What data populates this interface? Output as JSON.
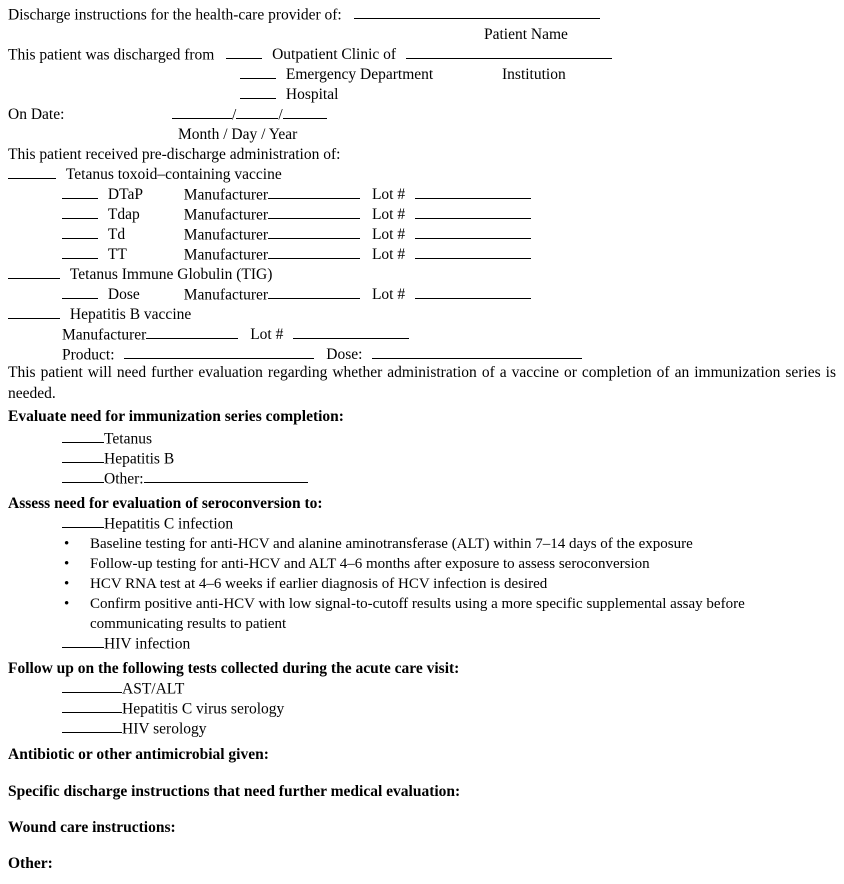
{
  "document": {
    "type": "discharge-instructions-form",
    "title_line": "Discharge instructions for the health-care provider of:",
    "patient_name_caption": "Patient Name"
  },
  "discharged_from": {
    "lead_text": "This patient was discharged from",
    "options": [
      "Outpatient Clinic of",
      "Emergency Department",
      "Hospital"
    ],
    "institution_caption": "Institution"
  },
  "date": {
    "label": "On Date:",
    "caption": "Month /  Day /  Year"
  },
  "predischarge": {
    "lead_text": "This patient received pre-discharge administration of:",
    "tetanus_vaccine_label": "Tetanus toxoid–containing vaccine",
    "vaccine_rows": [
      {
        "name": "DTaP",
        "manufacturer_label": "Manufacturer",
        "lot_label": "Lot #"
      },
      {
        "name": "Tdap",
        "manufacturer_label": "Manufacturer",
        "lot_label": "Lot #"
      },
      {
        "name": "Td",
        "manufacturer_label": "Manufacturer",
        "lot_label": "Lot #"
      },
      {
        "name": "TT",
        "manufacturer_label": "Manufacturer",
        "lot_label": "Lot #"
      }
    ],
    "tig_label": "Tetanus Immune Globulin (TIG)",
    "tig_row": {
      "name": "Dose",
      "manufacturer_label": "Manufacturer",
      "lot_label": "Lot #"
    },
    "hepb_label": "Hepatitis B vaccine",
    "hepb_manufacturer_label": "Manufacturer",
    "hepb_lot_label": "Lot #",
    "hepb_product_label": "Product:",
    "hepb_dose_label": "Dose:"
  },
  "further_eval_paragraph": "This patient will need further evaluation regarding whether administration of a vaccine or completion of an immunization series is needed.",
  "immunization_series": {
    "heading": "Evaluate need for immunization series completion:",
    "items": [
      "Tetanus",
      "Hepatitis B",
      "Other:"
    ]
  },
  "seroconversion": {
    "heading": "Assess need for evaluation of seroconversion to:",
    "hcv_item": "Hepatitis C infection",
    "bullets": [
      "Baseline testing for anti-HCV and alanine aminotransferase (ALT) within 7–14 days of the exposure",
      "Follow-up testing for anti-HCV and ALT 4–6 months after exposure to assess seroconversion",
      "HCV RNA test at 4–6 weeks if earlier diagnosis of HCV infection is desired",
      "Confirm positive anti-HCV with low signal-to-cutoff results using a more specific supplemental assay before communicating results to patient"
    ],
    "hiv_item": "HIV infection"
  },
  "followup_tests": {
    "heading": "Follow up on the following tests collected during the acute care visit:",
    "items": [
      "AST/ALT",
      "Hepatitis C virus serology",
      "HIV serology"
    ]
  },
  "closing_headings": [
    "Antibiotic or other antimicrobial given:",
    "Specific discharge instructions that need further medical evaluation:",
    "Wound care instructions:",
    "Other:"
  ]
}
